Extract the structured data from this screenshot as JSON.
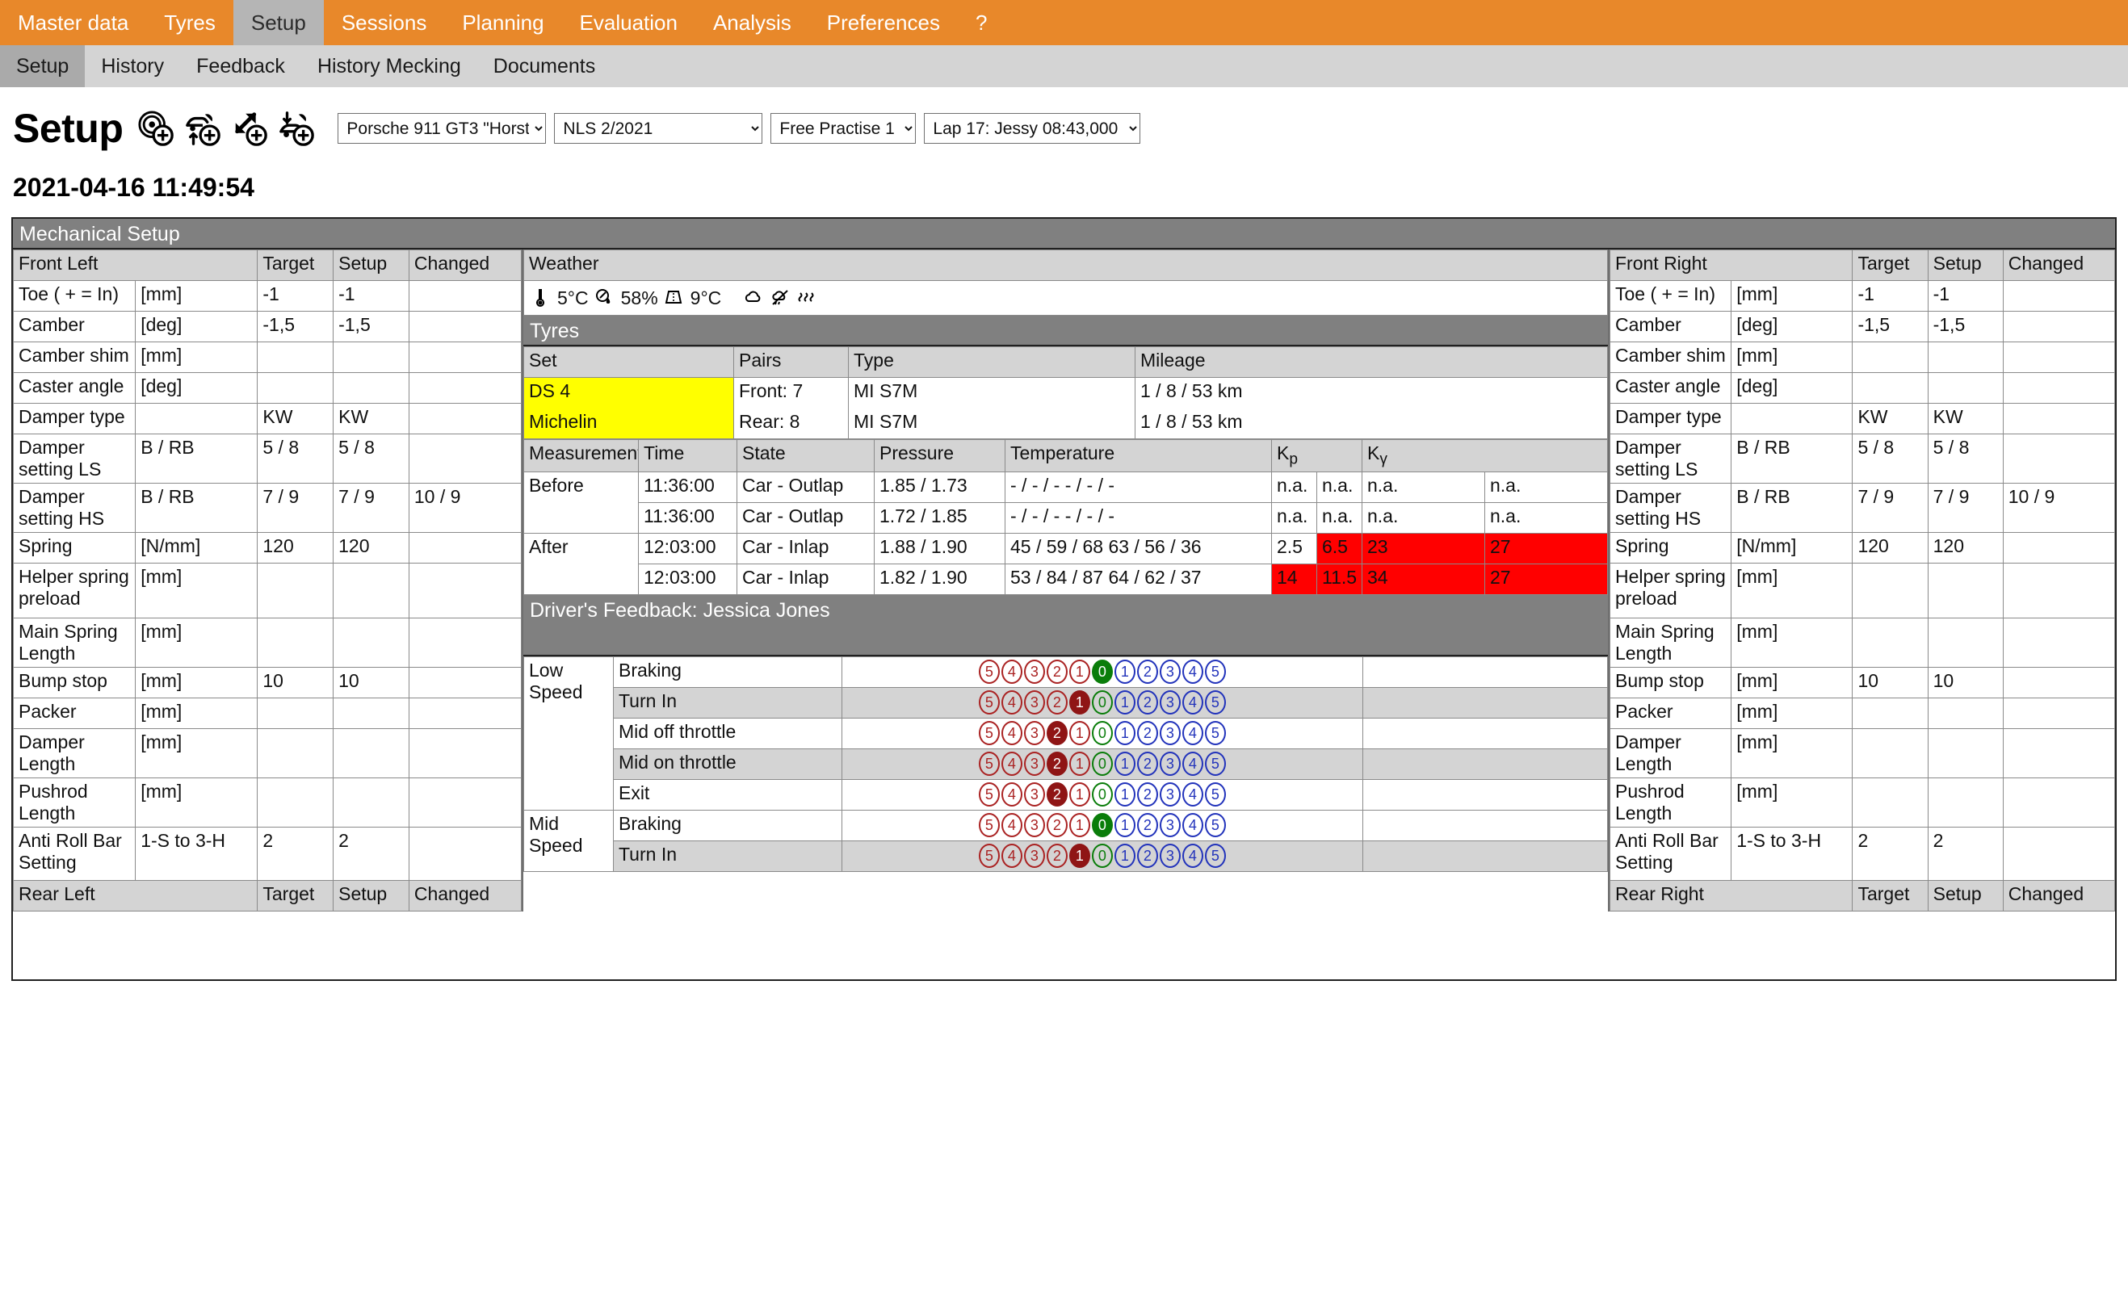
{
  "topnav": {
    "items": [
      {
        "label": "Master data",
        "active": false
      },
      {
        "label": "Tyres",
        "active": false
      },
      {
        "label": "Setup",
        "active": true
      },
      {
        "label": "Sessions",
        "active": false
      },
      {
        "label": "Planning",
        "active": false
      },
      {
        "label": "Evaluation",
        "active": false
      },
      {
        "label": "Analysis",
        "active": false
      },
      {
        "label": "Preferences",
        "active": false
      },
      {
        "label": "?",
        "active": false
      }
    ]
  },
  "subnav": {
    "items": [
      {
        "label": "Setup",
        "active": true
      },
      {
        "label": "History",
        "active": false
      },
      {
        "label": "Feedback",
        "active": false
      },
      {
        "label": "History Mecking",
        "active": false
      },
      {
        "label": "Documents",
        "active": false
      }
    ]
  },
  "header": {
    "title": "Setup",
    "icons": [
      "add-tyre-icon",
      "add-car-raise-icon",
      "add-resize-icon",
      "add-car-lower-icon"
    ],
    "selects": [
      {
        "name": "car-select",
        "value": "Porsche 911 GT3 \"Horst\""
      },
      {
        "name": "event-select",
        "value": "NLS 2/2021"
      },
      {
        "name": "session-select",
        "value": "Free Practise 1"
      },
      {
        "name": "lap-select",
        "value": "Lap 17: Jessy 08:43,000"
      }
    ],
    "timestamp": "2021-04-16 11:49:54"
  },
  "board": {
    "section_title": "Mechanical Setup"
  },
  "corner_columns": [
    "Target",
    "Setup",
    "Changed"
  ],
  "corners": {
    "front_left": {
      "title": "Front Left",
      "rows": [
        {
          "name": "Toe ( + = In)",
          "unit": "[mm]",
          "target": "-1",
          "setup": "-1",
          "changed": ""
        },
        {
          "name": "Camber",
          "unit": "[deg]",
          "target": "-1,5",
          "setup": "-1,5",
          "changed": ""
        },
        {
          "name": "Camber shim",
          "unit": "[mm]",
          "target": "",
          "setup": "",
          "changed": ""
        },
        {
          "name": "Caster angle",
          "unit": "[deg]",
          "target": "",
          "setup": "",
          "changed": ""
        },
        {
          "name": "Damper type",
          "unit": "",
          "target": "KW",
          "setup": "KW",
          "changed": ""
        },
        {
          "name": "Damper setting LS",
          "unit": "B / RB",
          "target": "5 / 8",
          "setup": "5 / 8",
          "changed": ""
        },
        {
          "name": "Damper setting HS",
          "unit": "B / RB",
          "target": "7 / 9",
          "setup": "7 / 9",
          "changed": "10 / 9"
        },
        {
          "name": "Spring",
          "unit": "[N/mm]",
          "target": "120",
          "setup": "120",
          "changed": ""
        },
        {
          "name": "Helper spring preload",
          "unit": "[mm]",
          "target": "",
          "setup": "",
          "changed": ""
        },
        {
          "name": "Main Spring Length",
          "unit": "[mm]",
          "target": "",
          "setup": "",
          "changed": ""
        },
        {
          "name": "Bump stop",
          "unit": "[mm]",
          "target": "10",
          "setup": "10",
          "changed": ""
        },
        {
          "name": "Packer",
          "unit": "[mm]",
          "target": "",
          "setup": "",
          "changed": ""
        },
        {
          "name": "Damper Length",
          "unit": "[mm]",
          "target": "",
          "setup": "",
          "changed": ""
        },
        {
          "name": "Pushrod Length",
          "unit": "[mm]",
          "target": "",
          "setup": "",
          "changed": ""
        },
        {
          "name": "Anti Roll Bar Setting",
          "unit": "1-S to 3-H",
          "target": "2",
          "setup": "2",
          "changed": ""
        }
      ],
      "next_title": "Rear Left"
    },
    "front_right": {
      "title": "Front Right",
      "rows": [
        {
          "name": "Toe ( + = In)",
          "unit": "[mm]",
          "target": "-1",
          "setup": "-1",
          "changed": ""
        },
        {
          "name": "Camber",
          "unit": "[deg]",
          "target": "-1,5",
          "setup": "-1,5",
          "changed": ""
        },
        {
          "name": "Camber shim",
          "unit": "[mm]",
          "target": "",
          "setup": "",
          "changed": ""
        },
        {
          "name": "Caster angle",
          "unit": "[deg]",
          "target": "",
          "setup": "",
          "changed": ""
        },
        {
          "name": "Damper type",
          "unit": "",
          "target": "KW",
          "setup": "KW",
          "changed": ""
        },
        {
          "name": "Damper setting LS",
          "unit": "B / RB",
          "target": "5 / 8",
          "setup": "5 / 8",
          "changed": ""
        },
        {
          "name": "Damper setting HS",
          "unit": "B / RB",
          "target": "7 / 9",
          "setup": "7 / 9",
          "changed": "10 / 9"
        },
        {
          "name": "Spring",
          "unit": "[N/mm]",
          "target": "120",
          "setup": "120",
          "changed": ""
        },
        {
          "name": "Helper spring preload",
          "unit": "[mm]",
          "target": "",
          "setup": "",
          "changed": ""
        },
        {
          "name": "Main Spring Length",
          "unit": "[mm]",
          "target": "",
          "setup": "",
          "changed": ""
        },
        {
          "name": "Bump stop",
          "unit": "[mm]",
          "target": "10",
          "setup": "10",
          "changed": ""
        },
        {
          "name": "Packer",
          "unit": "[mm]",
          "target": "",
          "setup": "",
          "changed": ""
        },
        {
          "name": "Damper Length",
          "unit": "[mm]",
          "target": "",
          "setup": "",
          "changed": ""
        },
        {
          "name": "Pushrod Length",
          "unit": "[mm]",
          "target": "",
          "setup": "",
          "changed": ""
        },
        {
          "name": "Anti Roll Bar Setting",
          "unit": "1-S to 3-H",
          "target": "2",
          "setup": "2",
          "changed": ""
        }
      ],
      "next_title": "Rear Right"
    }
  },
  "weather": {
    "header": "Weather",
    "air_temp": "5°C",
    "humidity": "58%",
    "track_temp": "9°C",
    "icons": [
      "thermometer-icon",
      "humidity-icon",
      "track-icon",
      "cloud-icon",
      "no-rain-icon",
      "wind-icon"
    ]
  },
  "tyres": {
    "header": "Tyres",
    "columns": [
      "Set",
      "Pairs",
      "Type",
      "Mileage"
    ],
    "rows": [
      {
        "set": "DS 4",
        "pairs": "Front: 7",
        "type": "MI S7M",
        "mileage": "1 / 8 / 53 km",
        "highlight": true
      },
      {
        "set": "Michelin",
        "pairs": "Rear: 8",
        "type": "MI S7M",
        "mileage": "1 / 8 / 53 km",
        "highlight": true
      }
    ]
  },
  "measurements": {
    "columns": [
      "Measurements",
      "Time",
      "State",
      "Pressure",
      "Temperature",
      "Kp",
      "Ky"
    ],
    "groups": [
      {
        "label": "Before",
        "rows": [
          {
            "time": "11:36:00",
            "state": "Car - Outlap",
            "pressure": "1.85 / 1.73",
            "temperature": "- / - / -   - / - / -",
            "kp1": "n.a.",
            "kp2": "n.a.",
            "ky1": "n.a.",
            "ky2": "n.a.",
            "kp1_red": false,
            "kp2_red": false,
            "ky1_red": false,
            "ky2_red": false
          },
          {
            "time": "11:36:00",
            "state": "Car - Outlap",
            "pressure": "1.72 / 1.85",
            "temperature": "- / - / -   - / - / -",
            "kp1": "n.a.",
            "kp2": "n.a.",
            "ky1": "n.a.",
            "ky2": "n.a.",
            "kp1_red": false,
            "kp2_red": false,
            "ky1_red": false,
            "ky2_red": false
          }
        ]
      },
      {
        "label": "After",
        "rows": [
          {
            "time": "12:03:00",
            "state": "Car - Inlap",
            "pressure": "1.88 / 1.90",
            "temperature": "45 / 59 / 68   63 / 56 / 36",
            "kp1": "2.5",
            "kp2": "6.5",
            "ky1": "23",
            "ky2": "27",
            "kp1_red": false,
            "kp2_red": true,
            "ky1_red": true,
            "ky2_red": true
          },
          {
            "time": "12:03:00",
            "state": "Car - Inlap",
            "pressure": "1.82 / 1.90",
            "temperature": "53 / 84 / 87   64 / 62 / 37",
            "kp1": "14",
            "kp2": "11.5",
            "ky1": "34",
            "ky2": "27",
            "kp1_red": true,
            "kp2_red": true,
            "ky1_red": true,
            "ky2_red": true
          }
        ]
      }
    ]
  },
  "feedback": {
    "header": "Driver's Feedback: Jessica Jones",
    "scale_left": [
      "5",
      "4",
      "3",
      "2",
      "1"
    ],
    "scale_zero": "0",
    "scale_right": [
      "1",
      "2",
      "3",
      "4",
      "5"
    ],
    "groups": [
      {
        "speed": "Low Speed",
        "rows": [
          {
            "label": "Braking",
            "selected": "0",
            "note": ""
          },
          {
            "label": "Turn In",
            "selected": "-1",
            "note": ""
          },
          {
            "label": "Mid off throttle",
            "selected": "-2",
            "note": ""
          },
          {
            "label": "Mid on throttle",
            "selected": "-2",
            "note": ""
          },
          {
            "label": "Exit",
            "selected": "-2",
            "note": ""
          }
        ]
      },
      {
        "speed": "Mid Speed",
        "rows": [
          {
            "label": "Braking",
            "selected": "0",
            "note": ""
          },
          {
            "label": "Turn In",
            "selected": "-1",
            "note": ""
          }
        ]
      }
    ]
  },
  "colors": {
    "brand_orange": "#e8882a",
    "subnav_grey": "#d4d4d4",
    "band_grey": "#808080",
    "highlight_yellow": "#ffff00",
    "alert_red": "#ff0000",
    "rating_red": "#aa2222",
    "rating_blue": "#2233bb",
    "rating_green": "#0a7d0a"
  }
}
